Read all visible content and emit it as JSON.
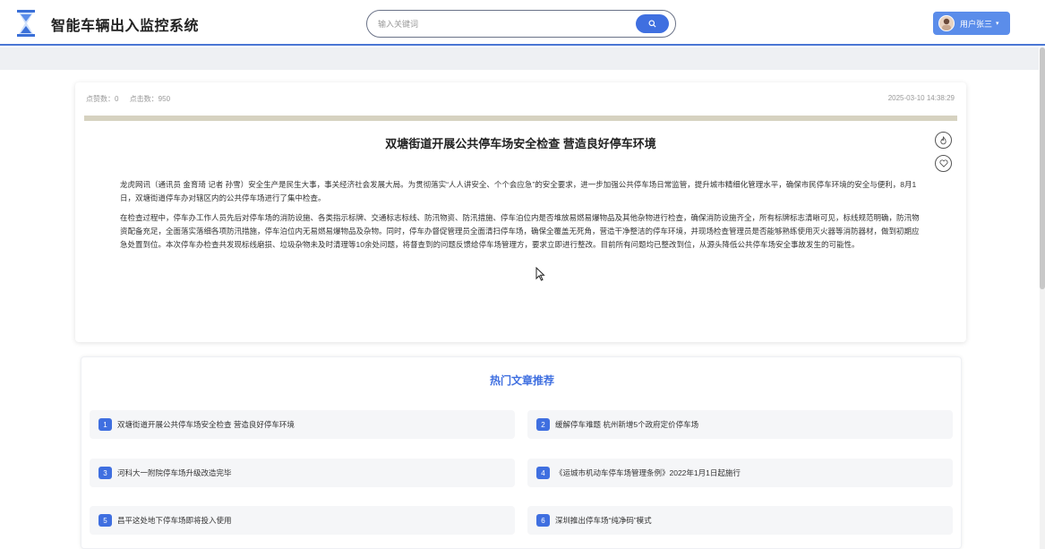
{
  "header": {
    "title": "智能车辆出入监控系统",
    "search_placeholder": "输入关键词",
    "user_label": "用户张三",
    "user_caret": "▾"
  },
  "article": {
    "likes_label": "点赞数：0",
    "clicks_label": "点击数：950",
    "time": "2025-03-10 14:38:29",
    "title": "双塘街道开展公共停车场安全检查 营造良好停车环境",
    "paragraphs": [
      "龙虎网讯（通讯员 金育琦 记者 孙雪）安全生产是民生大事，事关经济社会发展大局。为贯彻落实“人人讲安全、个个会应急”的安全要求，进一步加强公共停车场日常监管，提升城市精细化管理水平，确保市民停车环境的安全与便利，8月1日，双塘街道停车办对辖区内的公共停车场进行了集中检查。",
      "在检查过程中，停车办工作人员先后对停车场的消防设施、各类指示标牌、交通标志标线、防汛物资、防汛措施、停车泊位内是否堆放易燃易爆物品及其他杂物进行检查，确保消防设施齐全，所有标牌标志清晰可见，标线规范明确，防汛物资配备充足，全面落实落细各项防汛措施，停车泊位内无易燃易爆物品及杂物。同时，停车办督促管理员全面清扫停车场，确保全覆盖无死角，营造干净整洁的停车环境，并现场检查管理员是否能够熟练使用灭火器等消防器材，做到初期应急处置到位。本次停车办检查共发现标线磨损、垃圾杂物未及时清理等10余处问题，将督查到的问题反馈给停车场管理方，要求立即进行整改。目前所有问题均已整改到位，从源头降低公共停车场安全事故发生的可能性。"
    ]
  },
  "hot": {
    "title": "热门文章推荐",
    "items": [
      {
        "num": "1",
        "text": "双塘街道开展公共停车场安全检查 营造良好停车环境"
      },
      {
        "num": "2",
        "text": "缓解停车难题 杭州新增5个政府定价停车场"
      },
      {
        "num": "3",
        "text": "河科大一附院停车场升级改造完毕"
      },
      {
        "num": "4",
        "text": "《运城市机动车停车场管理条例》2022年1月1日起施行"
      },
      {
        "num": "5",
        "text": "昌平这处地下停车场即将投入使用"
      },
      {
        "num": "6",
        "text": "深圳推出停车场“纯净码”模式"
      }
    ]
  },
  "colors": {
    "accent": "#3f6fe0",
    "header_border": "#4a77d4",
    "user_button": "#5b8dea",
    "divider": "#d6d2c0"
  },
  "icons": [
    "hourglass-logo-icon",
    "search-icon",
    "avatar",
    "like-icon",
    "favorite-heart-icon",
    "mouse-cursor-icon"
  ]
}
